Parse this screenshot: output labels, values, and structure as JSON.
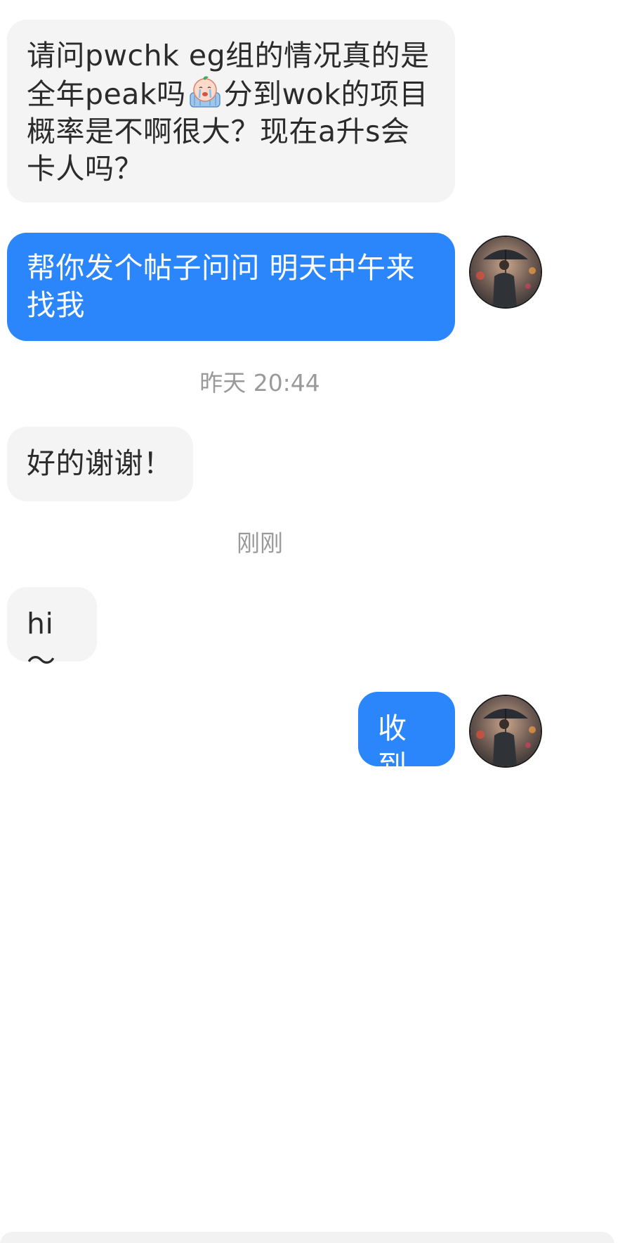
{
  "messages": [
    {
      "side": "incoming",
      "text_before_emoji": "请问pwchk eg组的情况真的是全年peak吗",
      "emoji": "crying-face-sticker",
      "text_after_emoji": "分到wok的项目概率是不啊很大？现在a升s会卡人吗？"
    },
    {
      "side": "outgoing",
      "text": "帮你发个帖子问问 明天中午来找我"
    },
    {
      "side": "timestamp",
      "text": "昨天 20:44"
    },
    {
      "side": "incoming",
      "text": "好的谢谢！"
    },
    {
      "side": "timestamp",
      "text": "刚刚"
    },
    {
      "side": "incoming",
      "text": "hi～"
    },
    {
      "side": "outgoing",
      "text": "收到"
    }
  ],
  "colors": {
    "incoming_bubble": "#f4f4f4",
    "outgoing_bubble": "#2b86fb",
    "timestamp_text": "#9a9a9a"
  },
  "icons": {
    "avatar": "person-with-umbrella-avatar",
    "sticker": "crying-face-sticker"
  }
}
